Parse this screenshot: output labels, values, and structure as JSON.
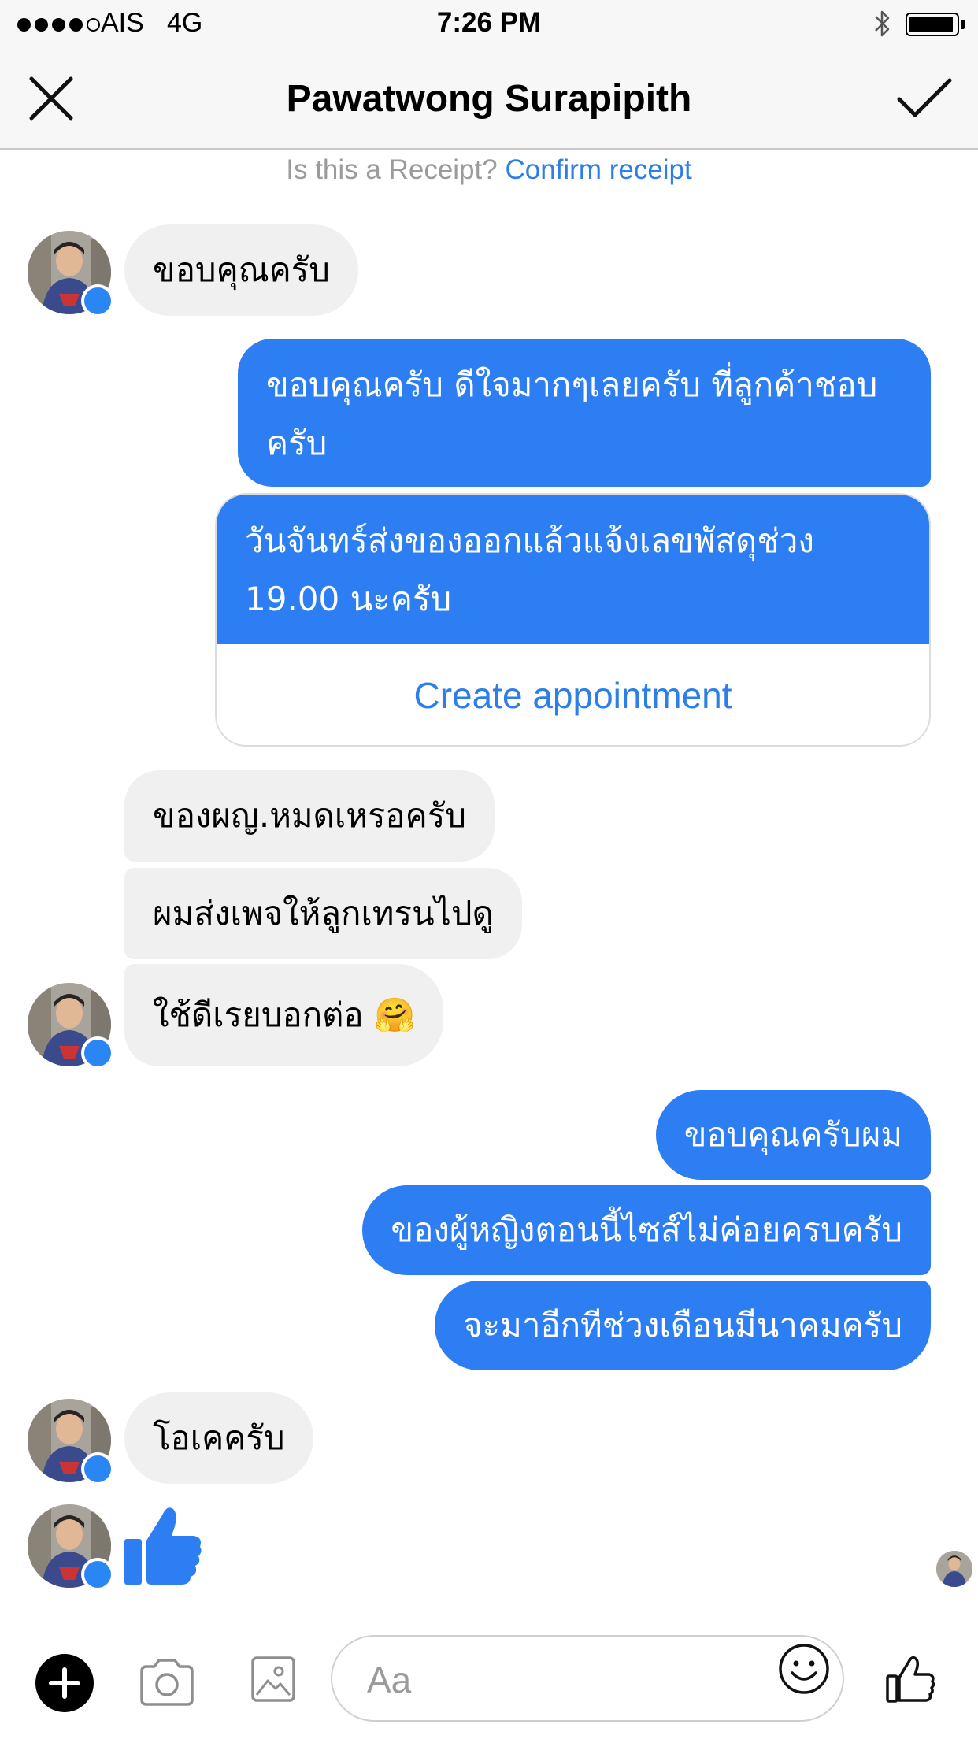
{
  "status_bar": {
    "carrier": "AIS",
    "network": "4G",
    "time": "7:26 PM",
    "signal_bars_filled": 4,
    "signal_bars_total": 5,
    "bluetooth_icon": "bluetooth-icon",
    "battery_level": 0.95
  },
  "header": {
    "title": "Pawatwong Surapipith",
    "close_icon": "close-icon",
    "confirm_icon": "checkmark-icon"
  },
  "receipt_prompt": {
    "question": "Is this a Receipt?",
    "action": "Confirm receipt"
  },
  "messages": [
    {
      "from": "them",
      "text": "ขอบคุณครับ"
    },
    {
      "from": "me",
      "text": "ขอบคุณครับ ดีใจมากๆเลยครับ ที่ลูกค้าชอบครับ"
    },
    {
      "from": "me",
      "text": "วันจันทร์ส่งของออกแล้วแจ้งเลขพัสดุช่วง 19.00 นะครับ",
      "action": "Create appointment"
    },
    {
      "from": "them",
      "text": "ของผญ.หมดเหรอครับ"
    },
    {
      "from": "them",
      "text": "ผมส่งเพจให้ลูกเทรนไปดู"
    },
    {
      "from": "them",
      "text": "ใช้ดีเรยบอกต่อ 🤗"
    },
    {
      "from": "me",
      "text": "ขอบคุณครับผม"
    },
    {
      "from": "me",
      "text": "ของผู้หญิงตอนนี้ไซส์ไม่ค่อยครบครับ"
    },
    {
      "from": "me",
      "text": "จะมาอีกทีช่วงเดือนมีนาคมครับ"
    },
    {
      "from": "them",
      "text": "โอเคครับ"
    },
    {
      "from": "them",
      "sticker": "thumbs-up-icon"
    }
  ],
  "composer": {
    "placeholder": "Aa",
    "icons": [
      "plus-icon",
      "camera-icon",
      "gallery-icon",
      "emoji-icon",
      "thumbs-up-icon"
    ]
  },
  "colors": {
    "outgoing_bubble": "#2c7ef2",
    "incoming_bubble": "#f0f0f0",
    "link": "#2d7ee6",
    "messenger_badge": "#2b86f5"
  }
}
